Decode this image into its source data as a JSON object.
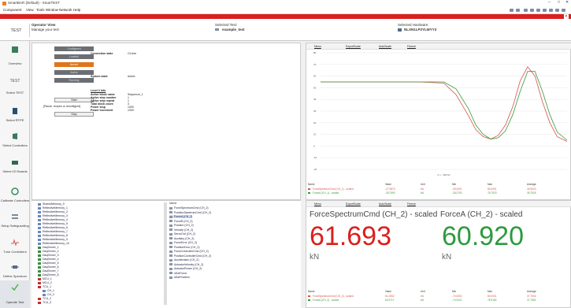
{
  "titlebar": {
    "title": "SmartBAR (Default) - SmarTEST"
  },
  "menu": [
    "Component",
    "View",
    "Tools",
    "Window",
    "Network",
    "Help"
  ],
  "header": {
    "test_label": "TEST",
    "view_title": "Operator View",
    "view_sub": "Manage your test",
    "selected_test_label": "Selected Test:",
    "selected_test_value": "example_test",
    "selected_hw_label": "Selected Hardware:",
    "selected_hw_value": "NLXN1LP2YLWYY3"
  },
  "nav": [
    {
      "label": "Overview"
    },
    {
      "label": "TEST"
    },
    {
      "label": "Select TEST"
    },
    {
      "label": "Select RTPE"
    },
    {
      "label": "Select Controllers"
    },
    {
      "label": "Select I/O Boards"
    },
    {
      "label": "Calibrate Controllers"
    },
    {
      "label": "Setup Safeguarding"
    },
    {
      "label": "Tune Controllers"
    },
    {
      "label": "Define Spectrum"
    },
    {
      "label": "Operate Test"
    }
  ],
  "operator": {
    "state_buttons": [
      "Configured",
      "Loaded",
      "Armed",
      "Active",
      "Running"
    ],
    "connection_label": "Connection state",
    "connection_value": "On line",
    "system_label": "System state",
    "system_value": "Active",
    "start_button": "Start",
    "stop_button": "Stop",
    "pause_text": "[Pause, reopen or reconfigure]",
    "level_title": "Level 0 Info",
    "info_rows": [
      {
        "k": "Active block name",
        "v": "Sequence_1"
      },
      {
        "k": "Active step number",
        "v": "1"
      },
      {
        "k": "Active step repeat",
        "v": "1"
      },
      {
        "k": "Total block count",
        "v": "3"
      },
      {
        "k": "Power stop",
        "v": "1000"
      },
      {
        "k": "Power Increment",
        "v": "1000"
      }
    ]
  },
  "tree_left": [
    "SharedMemory_0",
    "ReflectiveMemory_1",
    "ReflectiveMemory_2",
    "ReflectiveMemory_3",
    "ReflectiveMemory_4",
    "ReflectiveMemory_5",
    "ReflectiveMemory_6",
    "ReflectiveMemory_7",
    "ReflectiveMemory_8",
    "ReflectiveMemory_9",
    "ReflectiveMemory_10",
    "DaqServer_1",
    "DaqServer_2",
    "DaqServer_3",
    "DaqServer_4",
    "DaqServer_5",
    "DaqServer_6",
    "DaqServer_7",
    "DaqServer_8",
    "MCU_1",
    "MCU_2",
    "TCU_1",
    "CH_1",
    "CH_2",
    "TCU_2",
    "TCU_3"
  ],
  "tree_right_header": "Name",
  "tree_right": [
    "ForceSpectrumCmd (CH_2)",
    "PositionSpectrumCmd (CH_2)",
    "ForceA (CH_2)",
    "ForceB (CH_2)",
    "Position (CH_2)",
    "Velocity (CH_2)",
    "ServoOut (CH_2)",
    "Auxiliary (CH_2)",
    "ForceError (CH_2)",
    "PositionError (CH_2)",
    "ForceControllerCmd (CH_2)",
    "PositionControllerCmd (CH_2)",
    "Acceleration (CH_2)",
    "ActuatorVelocity (CH_2)",
    "ActuatorPower (CH_2)",
    "sEarForce",
    "sEarPosition"
  ],
  "chart_toolbar": [
    "Menu",
    "ExportScale",
    "AutoScale",
    "Freeze"
  ],
  "chart_data": {
    "type": "line",
    "xlabel": "X x - 400 Hz",
    "ylim": [
      -20,
      80
    ],
    "yticks": [
      -20,
      -10,
      0,
      10,
      20,
      30,
      40,
      50,
      60,
      70,
      80
    ],
    "x": [
      0,
      10,
      20,
      30,
      40,
      50,
      55,
      60,
      63,
      66,
      69,
      72,
      75,
      78,
      81,
      84,
      87,
      90,
      93,
      96,
      100
    ],
    "series": [
      {
        "name": "ForceSpectrumCmd (CH_1) - scaled",
        "color": "#d9534f",
        "values": [
          55,
          55,
          55,
          55,
          55,
          54,
          44,
          26,
          14,
          8,
          6,
          9,
          18,
          34,
          56,
          68,
          60,
          38,
          20,
          8,
          4
        ]
      },
      {
        "name": "ForceA (CH_1) - scaled",
        "color": "#3a9a3a",
        "values": [
          55,
          55,
          55,
          55,
          55,
          55,
          49,
          32,
          18,
          10,
          6,
          7,
          13,
          27,
          47,
          64,
          64,
          47,
          27,
          12,
          5
        ]
      }
    ]
  },
  "chart_legend": {
    "headers": [
      "Name",
      "Value",
      "Unit",
      "Min",
      "Max",
      "Average"
    ],
    "rows": [
      [
        "ForceSpectrumCmd (CH_1) - scaled",
        "-27.9873",
        "kN",
        "-39.0001",
        "80.0001",
        "34.9523"
      ],
      [
        "ForceA (CH_1) - scaled",
        "-28.7993",
        "kN",
        "-28.2792",
        "78.7523",
        "35.7525"
      ]
    ]
  },
  "gauges": [
    {
      "title": "ForceSpectrumCmd (CH_2) - scaled",
      "value": "61.693",
      "unit": "kN",
      "color": "#d9201e"
    },
    {
      "title": "ForceA (CH_2) - scaled",
      "value": "60.920",
      "unit": "kN",
      "color": "#2e9a3e"
    }
  ],
  "gauge_legend": {
    "headers": [
      "Name",
      "Value",
      "Unit",
      "Min",
      "Max",
      "Average"
    ],
    "rows": [
      [
        "ForceSpectrumCmd (CH_2) - scaled",
        "61.2552",
        "kN",
        "-70.0002",
        "80.0001",
        "37.7534"
      ],
      [
        "ForceA (CH_2) - scaled",
        "60.9717",
        "kN",
        "-74.0221",
        "78.9184",
        "37.7552"
      ]
    ]
  }
}
